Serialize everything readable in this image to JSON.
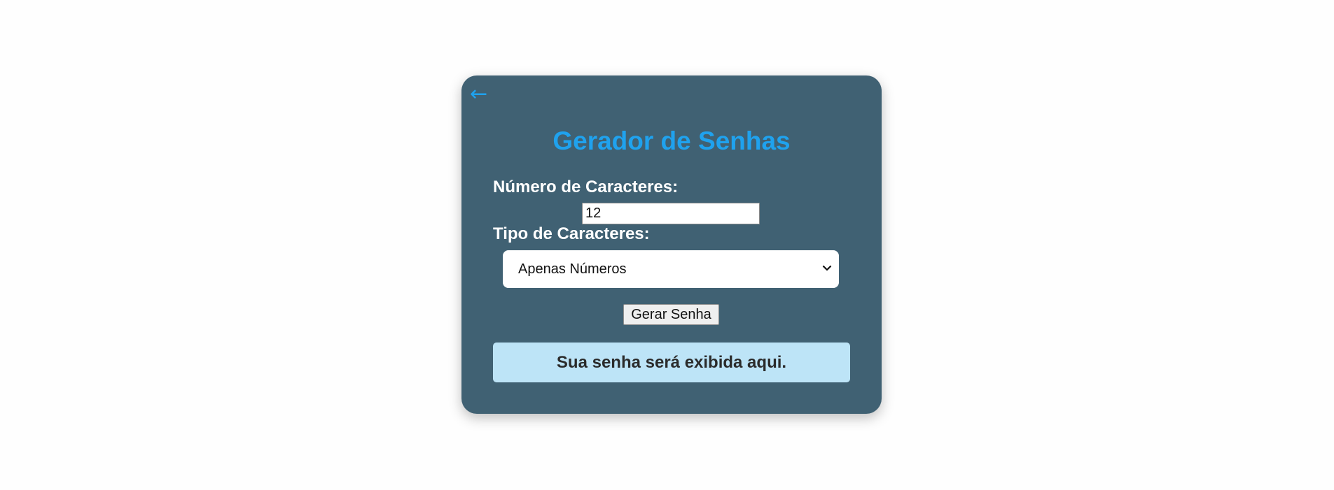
{
  "back_link": {
    "label": "←"
  },
  "title": "Gerador de Senhas",
  "form": {
    "length_label": "Número de Caracteres:",
    "length_value": "12",
    "type_label": "Tipo de Caracteres:",
    "type_selected": "Apenas Números",
    "generate_label": "Gerar Senha"
  },
  "result": {
    "text": "Sua senha será exibida aqui."
  },
  "colors": {
    "card_bg": "#406173",
    "accent": "#1fa2ee",
    "result_bg": "#bde4f7"
  },
  "icons": {
    "back": "arrow-left-icon",
    "dropdown": "chevron-down-icon"
  }
}
